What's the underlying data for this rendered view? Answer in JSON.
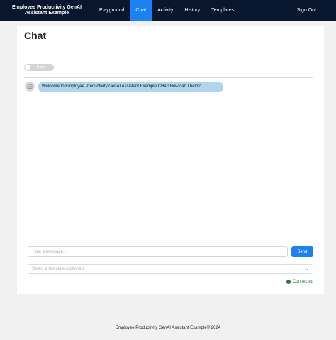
{
  "navbar": {
    "brand": "Employee Productivity GenAI Assistant Example",
    "items": [
      {
        "label": "Playground",
        "active": false
      },
      {
        "label": "Chat",
        "active": true
      },
      {
        "label": "Activity",
        "active": false
      },
      {
        "label": "History",
        "active": false
      },
      {
        "label": "Templates",
        "active": false
      }
    ],
    "signout": "Sign Out"
  },
  "chat": {
    "title": "Chat",
    "toggle_label": "Basic",
    "messages": [
      {
        "text": "Welcome to Employee Productivity GenAI Assistant Example CHat! How can I help?",
        "icon": "bot-icon"
      }
    ],
    "input_placeholder": "Type a message...",
    "send_label": "Send",
    "template_placeholder": "Select a template (optional)",
    "status": "Connected"
  },
  "colors": {
    "navbar": "#08162e",
    "accent": "#1b82f5",
    "bubble": "#aed6ed",
    "status": "#2e7d32"
  },
  "footer": {
    "text": "Employee Productivity GenAI Assistant Example© 2024"
  }
}
